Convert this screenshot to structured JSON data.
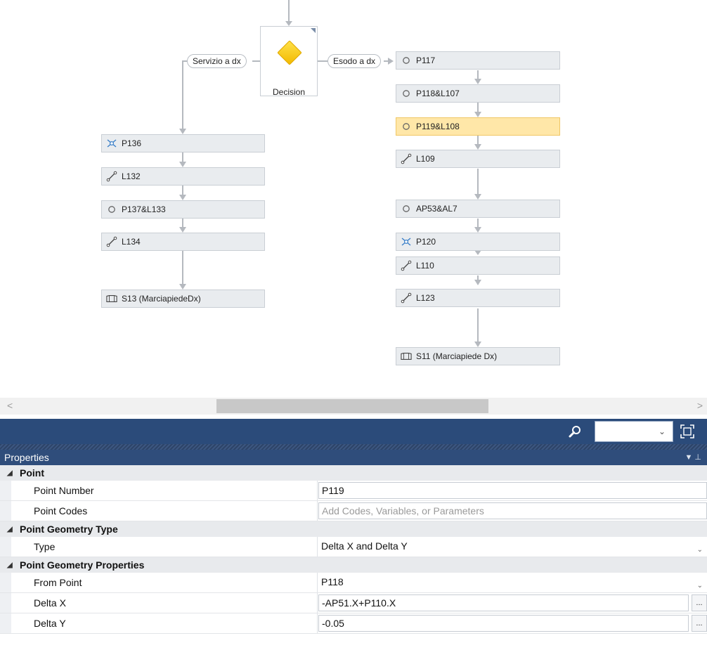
{
  "flow": {
    "decision": {
      "label": "Decision"
    },
    "branch_left_label": "Servizio a dx",
    "branch_right_label": "Esodo a dx",
    "left_nodes": [
      {
        "label": "P136",
        "icon": "point-intersection-icon"
      },
      {
        "label": "L132",
        "icon": "link-icon"
      },
      {
        "label": "P137&L133",
        "icon": "point-circle-icon"
      },
      {
        "label": "L134",
        "icon": "link-icon"
      },
      {
        "label": "S13 (MarciapiedeDx)",
        "icon": "shape-icon"
      }
    ],
    "right_nodes": [
      {
        "label": "P117",
        "icon": "point-circle-icon"
      },
      {
        "label": "P118&L107",
        "icon": "point-circle-icon"
      },
      {
        "label": "P119&L108",
        "icon": "point-circle-icon",
        "selected": true
      },
      {
        "label": "L109",
        "icon": "link-icon"
      },
      {
        "label": "AP53&AL7",
        "icon": "point-circle-icon"
      },
      {
        "label": "P120",
        "icon": "point-intersection-icon"
      },
      {
        "label": "L110",
        "icon": "link-icon"
      },
      {
        "label": "L123",
        "icon": "link-icon"
      },
      {
        "label": "S11 (Marciapiede Dx)",
        "icon": "shape-icon"
      }
    ]
  },
  "scrollbar": {
    "left_arrow": "<",
    "right_arrow": ">"
  },
  "toolbar": {
    "search_icon": "search-icon",
    "fit_icon": "fit-view-icon",
    "combo_value": ""
  },
  "properties": {
    "title": "Properties",
    "sections": [
      {
        "title": "Point",
        "rows": [
          {
            "name": "Point Number",
            "value": "P119"
          },
          {
            "name": "Point Codes",
            "placeholder": "Add Codes, Variables, or Parameters"
          }
        ]
      },
      {
        "title": "Point Geometry Type",
        "rows": [
          {
            "name": "Type",
            "value": "Delta X and Delta Y",
            "dropdown": true
          }
        ]
      },
      {
        "title": "Point Geometry Properties",
        "rows": [
          {
            "name": "From Point",
            "value": "P118",
            "dropdown": true
          },
          {
            "name": "Delta X",
            "value": "-AP51.X+P110.X",
            "ellipsis": true
          },
          {
            "name": "Delta Y",
            "value": "-0.05",
            "ellipsis": true
          }
        ]
      }
    ]
  }
}
